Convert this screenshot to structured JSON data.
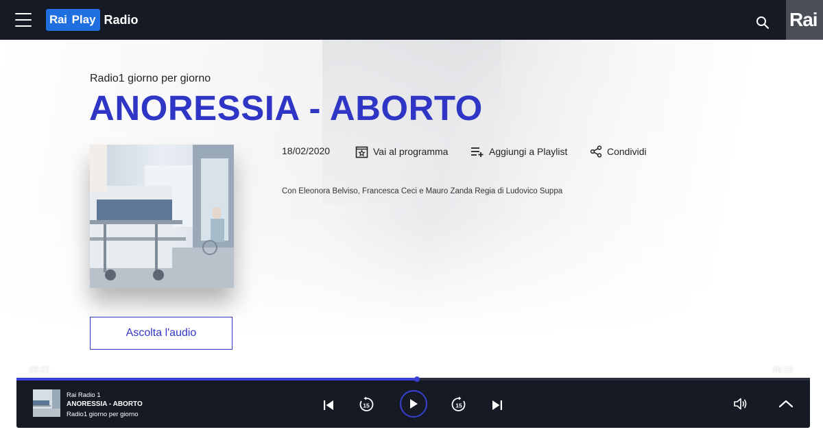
{
  "header": {
    "logo_rai": "Rai",
    "logo_play": "Play",
    "logo_radio": "Radio",
    "corner_logo": "Rai",
    "icons": [
      "menu-icon",
      "search-icon"
    ]
  },
  "episode": {
    "program_name": "Radio1 giorno per giorno",
    "title": "ANORESSIA - ABORTO",
    "date": "18/02/2020",
    "description": "Con Eleonora Belviso, Francesca Ceci e Mauro Zanda Regia di Ludovico Suppa"
  },
  "actions": {
    "program": "Vai al programma",
    "playlist": "Aggiungi a Playlist",
    "share": "Condividi"
  },
  "listen_button": "Ascolta l'audio",
  "player": {
    "elapsed": "23:22",
    "total": "46:19",
    "progress": 0.505,
    "channel": "Rai Radio 1",
    "title": "ANORESSIA - ABORTO",
    "program": "Radio1 giorno per giorno",
    "skip_seconds": "15"
  },
  "colors": {
    "accent": "#2f35c4",
    "dark_bar": "#151a24",
    "brand_blue": "#1f6fe0"
  }
}
